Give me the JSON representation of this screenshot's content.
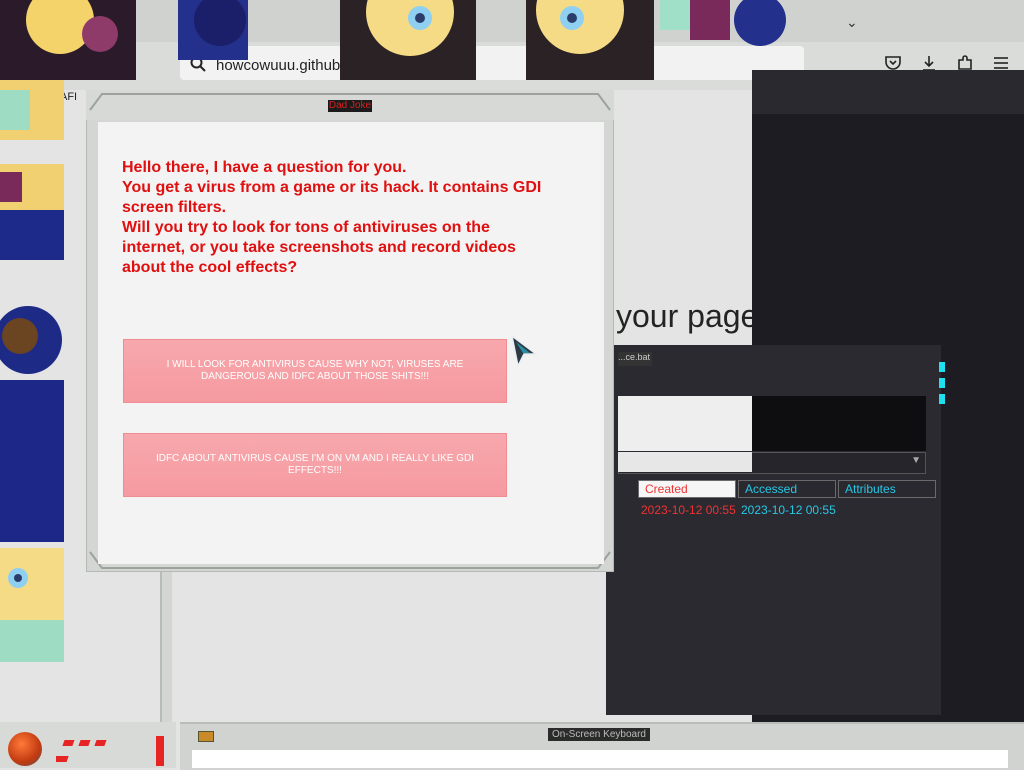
{
  "browser": {
    "url": "howcowuuu.github.io/DadJoke.zip",
    "tab_partial_label": "AFI"
  },
  "background": {
    "headline_fragment": "your pages back."
  },
  "explorer": {
    "lower_window_title": "...ce.bat",
    "columns": [
      "Created",
      "Accessed",
      "Attributes"
    ],
    "row": {
      "created": "2023-10-12 00:55",
      "accessed": "2023-10-12 00:55"
    }
  },
  "dialog": {
    "title": "Dad Joke",
    "message": "Hello there, I have a question for you.\nYou get a virus from a game or its hack. It contains GDI screen filters.\nWill you try to look for tons of antiviruses on the internet, or you take screenshots and record videos about the cool effects?",
    "button_antivirus": "I WILL LOOK FOR ANTIVIRUS CAUSE WHY NOT, VIRUSES ARE DANGEROUS AND IDFC ABOUT THOSE SHITS!!!",
    "button_idgaf": "IDFC ABOUT ANTIVIRUS CAUSE I'M ON VM AND I REALLY LIKE GDI EFFECTS!!!"
  },
  "keyboard_window": {
    "title": "On-Screen Keyboard"
  },
  "colors": {
    "dialog_text": "#e01010",
    "button_fill": "#f7a8ad",
    "accent_cyan": "#26c8e6",
    "led_red": "#e62424"
  },
  "icons": {
    "nav_back": "arrow-left-icon",
    "nav_forward": "arrow-right-icon",
    "reload": "reload-icon",
    "search": "search-icon",
    "pocket": "pocket-icon",
    "downloads": "download-icon",
    "extensions": "puzzle-icon",
    "menu": "hamburger-icon",
    "tab_list": "chevron-down-icon",
    "cursor": "cursor-icon"
  }
}
